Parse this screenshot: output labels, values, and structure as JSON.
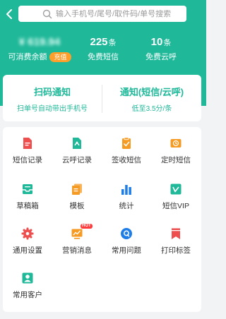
{
  "search": {
    "placeholder": "输入手机号/尾号/取件码/单号搜索"
  },
  "stats": {
    "balance": {
      "value": "¥ 619.94",
      "label": "可消费余额",
      "badge": "充值"
    },
    "sms": {
      "value": "225",
      "unit": "条",
      "label": "免费短信"
    },
    "cloud": {
      "value": "10",
      "unit": "条",
      "label": "免费云呼"
    }
  },
  "notice": {
    "left": {
      "title": "扫码通知",
      "subtitle": "扫单号自动带出手机号"
    },
    "right": {
      "title": "通知(短信/云呼)",
      "subtitle": "低至3.5分/条"
    }
  },
  "menu": [
    {
      "label": "短信记录",
      "icon": "sms-record-icon"
    },
    {
      "label": "云呼记录",
      "icon": "call-record-icon"
    },
    {
      "label": "签收短信",
      "icon": "sign-sms-icon"
    },
    {
      "label": "定时短信",
      "icon": "timer-sms-icon"
    },
    {
      "label": "草稿箱",
      "icon": "draft-box-icon"
    },
    {
      "label": "模板",
      "icon": "template-icon"
    },
    {
      "label": "统计",
      "icon": "statistics-icon"
    },
    {
      "label": "短信VIP",
      "icon": "sms-vip-icon"
    },
    {
      "label": "通用设置",
      "icon": "settings-icon"
    },
    {
      "label": "营销消息",
      "icon": "marketing-icon",
      "badge": "HOT"
    },
    {
      "label": "常用问题",
      "icon": "faq-icon"
    },
    {
      "label": "打印标签",
      "icon": "print-label-icon"
    },
    {
      "label": "常用客户",
      "icon": "customer-icon"
    }
  ],
  "colors": {
    "brand": "#1fb899",
    "red": "#ef4e4e",
    "green": "#1fb899",
    "orange": "#f59a23",
    "blue": "#1e7de6",
    "badge": "#ff9f2b"
  }
}
